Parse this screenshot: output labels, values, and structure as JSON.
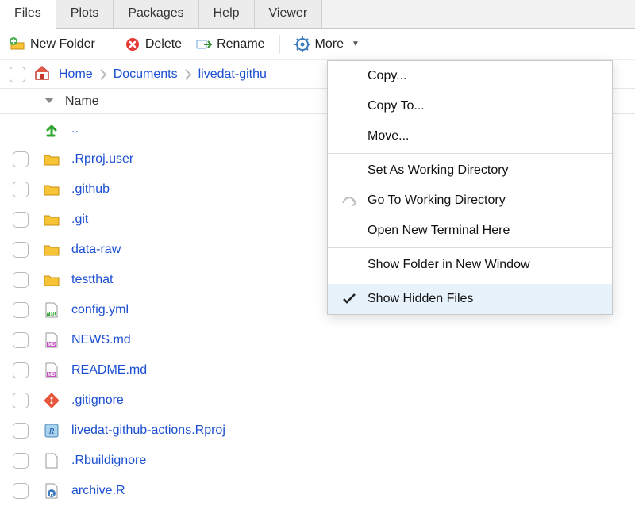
{
  "tabs": {
    "items": [
      {
        "label": "Files",
        "active": true
      },
      {
        "label": "Plots",
        "active": false
      },
      {
        "label": "Packages",
        "active": false
      },
      {
        "label": "Help",
        "active": false
      },
      {
        "label": "Viewer",
        "active": false
      }
    ]
  },
  "toolbar": {
    "new_folder": "New Folder",
    "delete": "Delete",
    "rename": "Rename",
    "more": "More"
  },
  "breadcrumb": {
    "items": [
      "Home",
      "Documents",
      "livedat-githu"
    ]
  },
  "table": {
    "name_header": "Name",
    "up_label": ".."
  },
  "files": [
    {
      "name": ".Rproj.user",
      "icon": "folder"
    },
    {
      "name": ".github",
      "icon": "folder"
    },
    {
      "name": ".git",
      "icon": "folder"
    },
    {
      "name": "data-raw",
      "icon": "folder"
    },
    {
      "name": "testthat",
      "icon": "folder"
    },
    {
      "name": "config.yml",
      "icon": "yml"
    },
    {
      "name": "NEWS.md",
      "icon": "md"
    },
    {
      "name": "README.md",
      "icon": "md"
    },
    {
      "name": ".gitignore",
      "icon": "git"
    },
    {
      "name": "livedat-github-actions.Rproj",
      "icon": "rproj"
    },
    {
      "name": ".Rbuildignore",
      "icon": "doc"
    },
    {
      "name": "archive.R",
      "icon": "r"
    }
  ],
  "menu": {
    "items": [
      {
        "label": "Copy...",
        "section": 0
      },
      {
        "label": "Copy To...",
        "section": 0
      },
      {
        "label": "Move...",
        "section": 0
      },
      {
        "label": "Set As Working Directory",
        "section": 1
      },
      {
        "label": "Go To Working Directory",
        "section": 1,
        "icon": "goto"
      },
      {
        "label": "Open New Terminal Here",
        "section": 1
      },
      {
        "label": "Show Folder in New Window",
        "section": 2
      },
      {
        "label": "Show Hidden Files",
        "section": 3,
        "checked": true,
        "highlight": true
      }
    ]
  }
}
